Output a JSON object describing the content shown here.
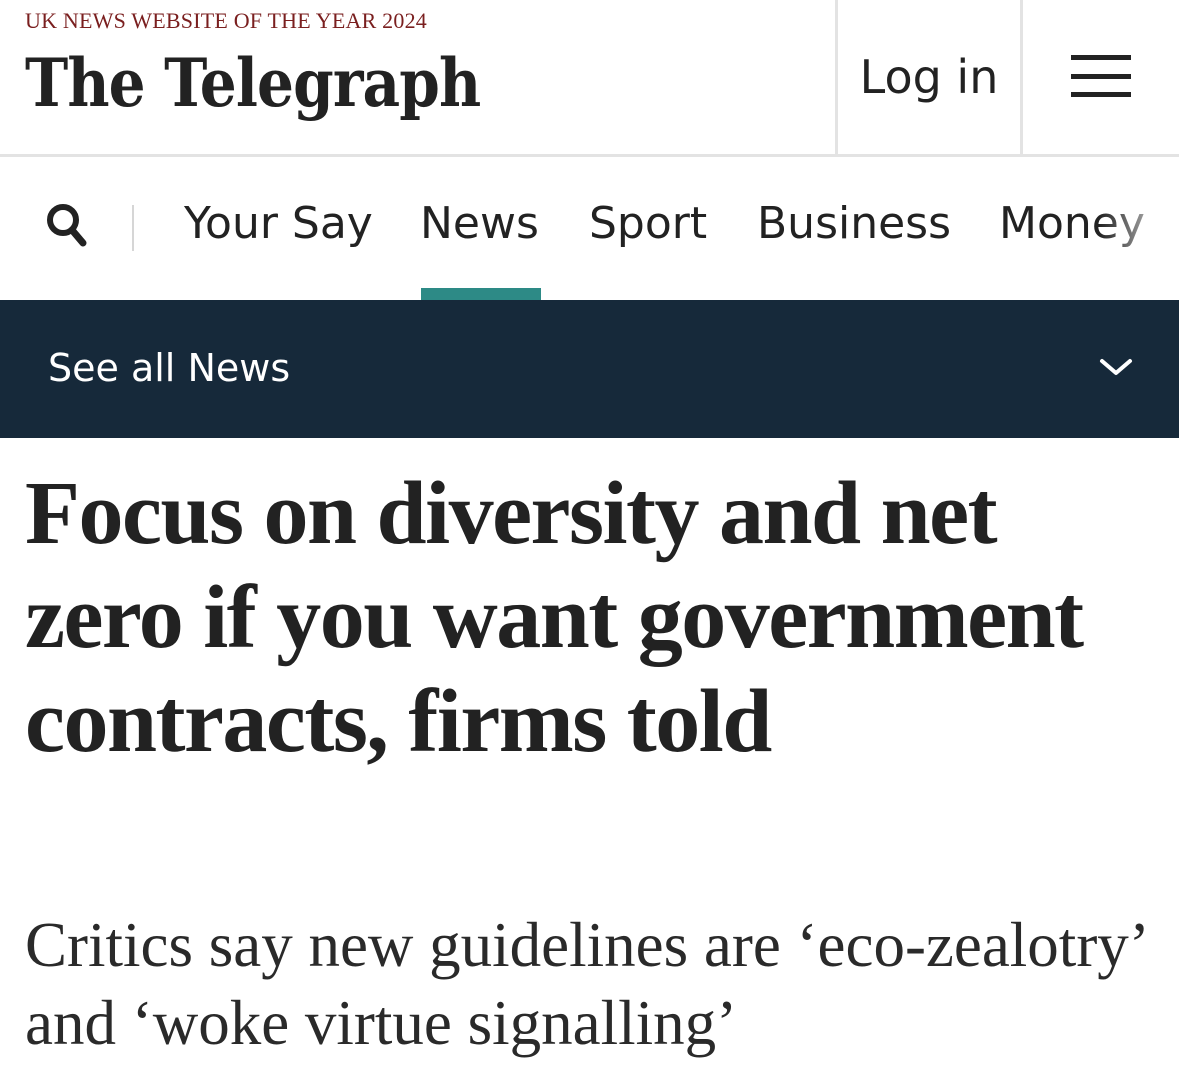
{
  "masthead": {
    "award": "UK NEWS WEBSITE OF THE YEAR 2024",
    "logo": "The Telegraph",
    "login_label": "Log in",
    "menu_icon": "hamburger-menu-icon"
  },
  "nav": {
    "search_icon": "search-icon",
    "items": [
      {
        "label": "Your Say"
      },
      {
        "label": "News",
        "active": true
      },
      {
        "label": "Sport"
      },
      {
        "label": "Business"
      },
      {
        "label": "Money"
      }
    ],
    "active_color": "#2d8a86"
  },
  "section_bar": {
    "label": "See all News",
    "icon": "chevron-down-icon",
    "background": "#16293a"
  },
  "article": {
    "headline": "Focus on diversity and net zero if you want government contracts, firms told",
    "standfirst": "Critics say new guidelines are ‘eco-zealotry’ and ‘woke virtue signalling’"
  },
  "colors": {
    "award_red": "#7a1f1f",
    "text": "#222222"
  }
}
